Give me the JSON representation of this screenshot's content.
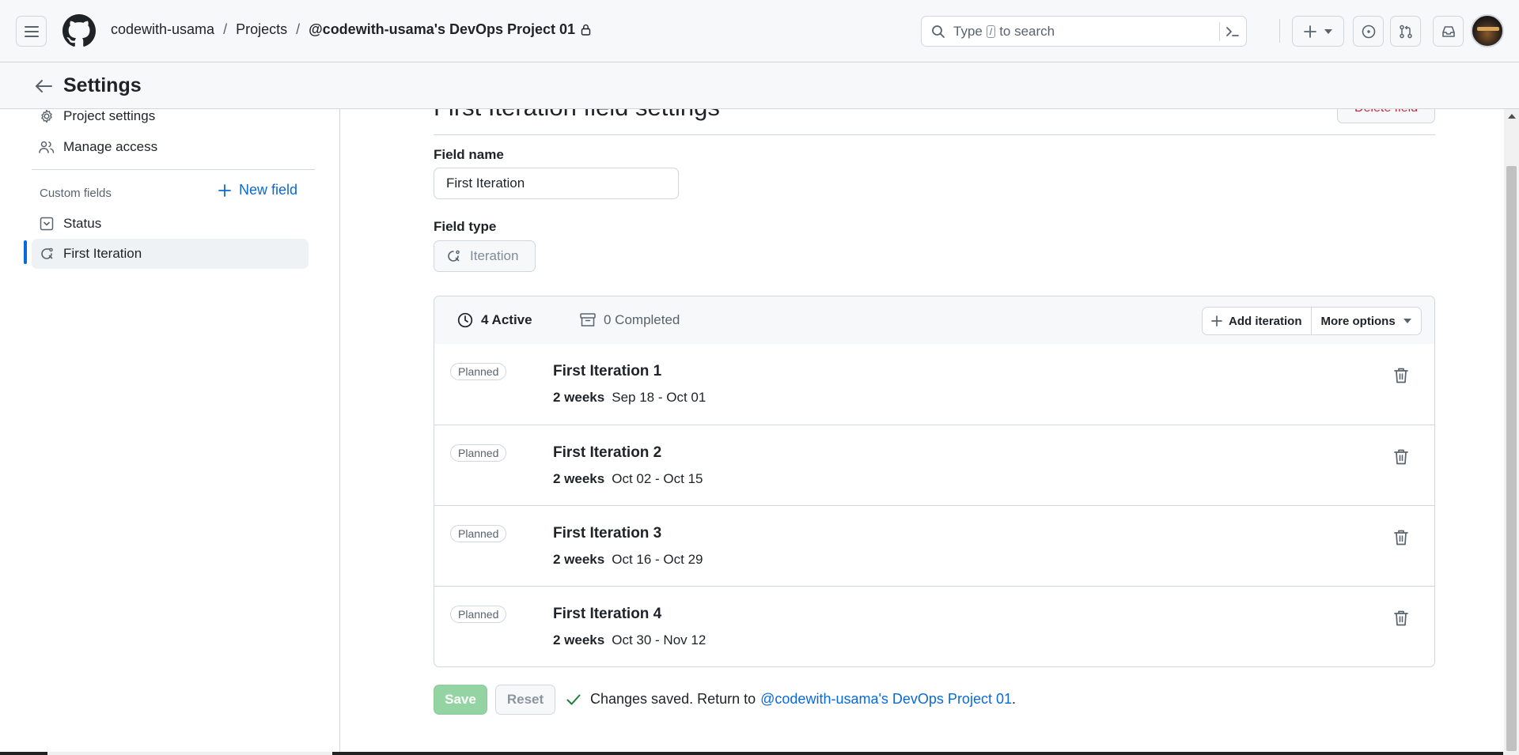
{
  "header": {
    "breadcrumb": {
      "owner": "codewith-usama",
      "separator": "/",
      "section": "Projects",
      "project": "@codewith-usama's DevOps Project 01"
    },
    "search": {
      "prefix": "Type",
      "key": "/",
      "suffix": "to search"
    }
  },
  "settings_bar": {
    "title": "Settings"
  },
  "sidebar": {
    "items": [
      {
        "label": "Project settings",
        "icon": "gear-icon"
      },
      {
        "label": "Manage access",
        "icon": "people-icon"
      }
    ],
    "custom_fields_label": "Custom fields",
    "new_field_label": "New field",
    "fields": [
      {
        "label": "Status",
        "icon": "single-select-icon"
      },
      {
        "label": "First Iteration",
        "icon": "iterations-icon",
        "active": true
      }
    ]
  },
  "main": {
    "title": "First Iteration field settings",
    "delete_label": "Delete field",
    "field_name_label": "Field name",
    "field_name_value": "First Iteration",
    "field_type_label": "Field type",
    "field_type_value": "Iteration",
    "tabs": {
      "active": "4 Active",
      "completed": "0 Completed"
    },
    "add_iteration_label": "Add iteration",
    "more_options_label": "More options",
    "iterations": [
      {
        "status": "Planned",
        "name": "First Iteration 1",
        "duration": "2 weeks",
        "dates": "Sep 18 - Oct 01"
      },
      {
        "status": "Planned",
        "name": "First Iteration 2",
        "duration": "2 weeks",
        "dates": "Oct 02 - Oct 15"
      },
      {
        "status": "Planned",
        "name": "First Iteration 3",
        "duration": "2 weeks",
        "dates": "Oct 16 - Oct 29"
      },
      {
        "status": "Planned",
        "name": "First Iteration 4",
        "duration": "2 weeks",
        "dates": "Oct 30 - Nov 12"
      }
    ],
    "save_label": "Save",
    "reset_label": "Reset",
    "status_text": "Changes saved. Return to",
    "status_link": "@codewith-usama's DevOps Project 01",
    "status_end": "."
  },
  "colors": {
    "accent": "#0969da",
    "danger": "#d1242f",
    "success": "#1a7f37",
    "save_disabled": "#94d3a2"
  }
}
